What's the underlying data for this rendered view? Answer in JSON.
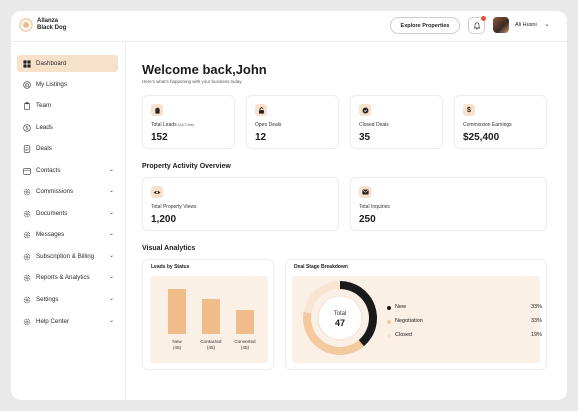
{
  "brand": {
    "name_line1": "Allanza",
    "name_line2": "Black Dog"
  },
  "header": {
    "explore_label": "Explore Properties",
    "user_name": "Ali Husni"
  },
  "sidebar": {
    "items": [
      {
        "label": "Dashboard",
        "icon": "grid-icon",
        "active": true,
        "has_submenu": false
      },
      {
        "label": "My Listings",
        "icon": "home-icon",
        "active": false,
        "has_submenu": false
      },
      {
        "label": "Team",
        "icon": "clipboard-icon",
        "active": false,
        "has_submenu": false
      },
      {
        "label": "Leads",
        "icon": "dollar-icon",
        "active": false,
        "has_submenu": false
      },
      {
        "label": "Deals",
        "icon": "document-icon",
        "active": false,
        "has_submenu": false
      },
      {
        "label": "Contacts",
        "icon": "calendar-icon",
        "active": false,
        "has_submenu": true
      },
      {
        "label": "Commissions",
        "icon": "gear-icon",
        "active": false,
        "has_submenu": true
      },
      {
        "label": "Documents",
        "icon": "gear-icon",
        "active": false,
        "has_submenu": true
      },
      {
        "label": "Messages",
        "icon": "gear-icon",
        "active": false,
        "has_submenu": true
      },
      {
        "label": "Subscription & Billing",
        "icon": "gear-icon",
        "active": false,
        "has_submenu": true
      },
      {
        "label": "Reports & Analytics",
        "icon": "gear-icon",
        "active": false,
        "has_submenu": true
      },
      {
        "label": "Settings",
        "icon": "gear-icon",
        "active": false,
        "has_submenu": true
      },
      {
        "label": "Help Center",
        "icon": "gear-icon",
        "active": false,
        "has_submenu": true
      }
    ]
  },
  "main": {
    "welcome": "Welcome back,John",
    "subtitle": "Here's what's happening with your business today.",
    "stats": [
      {
        "label": "Total Leads",
        "note": "(All-Time)",
        "value": "152",
        "icon": "clipboard-icon"
      },
      {
        "label": "Open Deals",
        "note": "",
        "value": "12",
        "icon": "unlock-icon"
      },
      {
        "label": "Closed Deals",
        "note": "",
        "value": "35",
        "icon": "check-circle-icon"
      },
      {
        "label": "Commission Earnings",
        "note": "",
        "value": "$25,400",
        "icon": "dollar-icon"
      }
    ],
    "activity_title": "Property Activity Overview",
    "activity": [
      {
        "label": "Total Property Views",
        "value": "1,200",
        "icon": "eye-icon"
      },
      {
        "label": "Total Inquiries",
        "value": "250",
        "icon": "mail-icon"
      }
    ],
    "analytics_title": "Visual Analytics"
  },
  "chart_data": [
    {
      "type": "bar",
      "title": "Leads by Status",
      "categories": [
        "New",
        "Contacted",
        "Converted"
      ],
      "values": [
        45,
        35,
        24
      ],
      "category_labels": [
        "New\n(45)",
        "Contacted\n(45)",
        "Converted\n(45)"
      ],
      "ylim": [
        0,
        50
      ],
      "color": "#f0bd8a"
    },
    {
      "type": "pie",
      "title": "Deal Stage Breakdown",
      "center_label": "Total",
      "center_value": "47",
      "labels": [
        "New",
        "Negotiation",
        "Closed"
      ],
      "values": [
        33,
        33,
        19
      ],
      "value_labels": [
        "33%",
        "33%",
        "19%"
      ],
      "colors": [
        "#1a1a1a",
        "#f3c99d",
        "#f8e6d3"
      ]
    }
  ]
}
